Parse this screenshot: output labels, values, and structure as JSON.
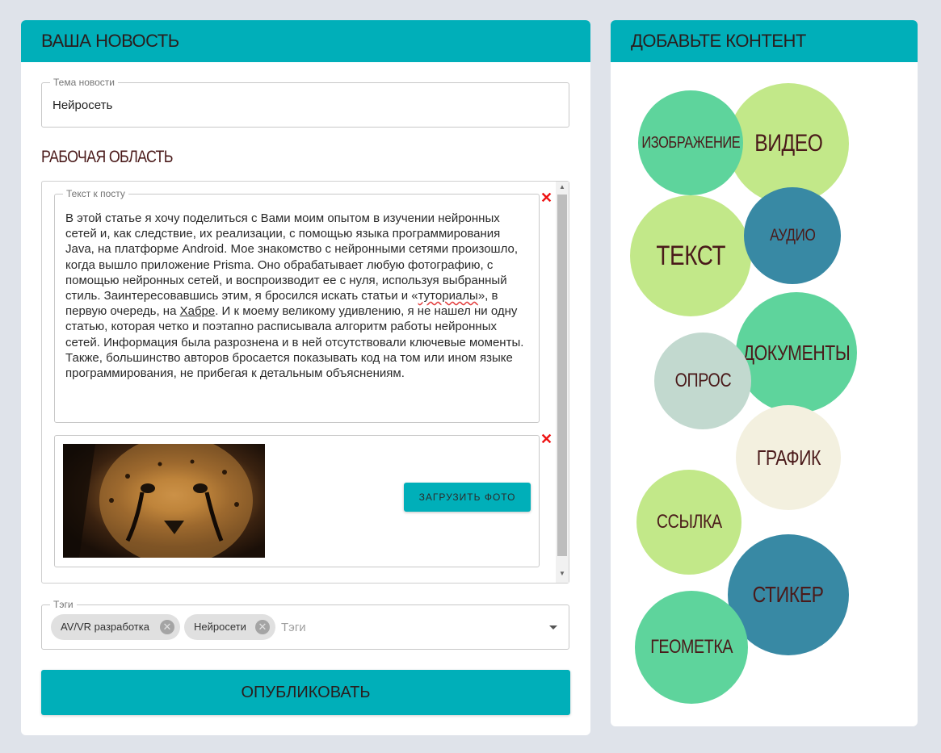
{
  "left_panel": {
    "title": "Ваша новость",
    "topic": {
      "legend": "Тема новости",
      "value": "Нейросеть"
    },
    "workspace_title": "Рабочая область",
    "text_block": {
      "legend": "Текст к посту",
      "text_before_spell": "В этой статье я хочу поделиться с Вами моим опытом в изучении нейронных сетей и, как следствие, их реализации, с помощью языка программирования Java, на платформе Android. Мое знакомство с нейронными сетями произошло, когда вышло приложение Prisma. Оно обрабатывает любую фотографию, с помощью нейронных сетей, и воспроизводит ее с нуля, используя выбранный стиль. Заинтересовавшись этим, я бросился искать статьи и «",
      "spell_word": "туториалы",
      "text_mid": "», в первую очередь, на ",
      "link_word": "Хабре",
      "text_after": ". И к моему великому удивлению, я не нашел ни одну статью, которая четко и поэтапно расписывала алгоритм работы нейронных сетей. Информация была разрознена и в ней отсутствовали ключевые моменты. Также, большинство авторов бросается показывать код на том или ином языке программирования, не прибегая к детальным объяснениям."
    },
    "photo_block": {
      "upload_label": "Загрузить фото"
    },
    "tags": {
      "legend": "Тэги",
      "chips": [
        "AV/VR разработка",
        "Нейросети"
      ],
      "placeholder": "Тэги"
    },
    "publish_label": "Опубликовать"
  },
  "right_panel": {
    "title": "Добавьте контент",
    "bubbles": [
      {
        "label": "Изображение",
        "color": "#5ed49c"
      },
      {
        "label": "Видео",
        "color": "#c2e889"
      },
      {
        "label": "Текст",
        "color": "#c2e889"
      },
      {
        "label": "Аудио",
        "color": "#3889a4"
      },
      {
        "label": "Документы",
        "color": "#5ed49c"
      },
      {
        "label": "Опрос",
        "color": "#c2d9cf"
      },
      {
        "label": "График",
        "color": "#f3f0df"
      },
      {
        "label": "Ссылка",
        "color": "#c2e889"
      },
      {
        "label": "Стикер",
        "color": "#3889a4"
      },
      {
        "label": "Геометка",
        "color": "#5ed49c"
      }
    ]
  },
  "colors": {
    "accent": "#00afb9",
    "remove": "#ee1111",
    "heading": "#4a1a1a"
  },
  "icons": [
    "remove-x-icon",
    "chip-close-icon",
    "dropdown-arrow-icon",
    "scroll-up-icon",
    "scroll-down-icon"
  ]
}
